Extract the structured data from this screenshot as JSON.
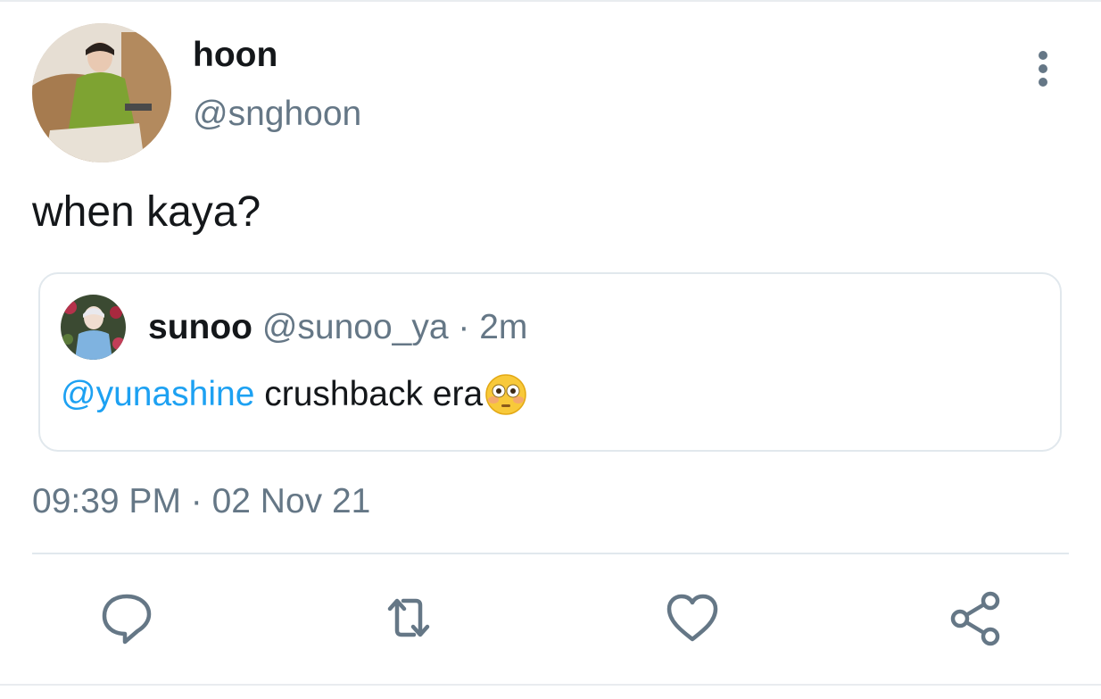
{
  "tweet": {
    "author": {
      "display_name": "hoon",
      "handle": "@snghoon"
    },
    "text": "when kaya?",
    "quoted": {
      "display_name": "sunoo",
      "handle": "@sunoo_ya",
      "separator": " · ",
      "time_ago": "2m",
      "mention": "@yunashine",
      "text": " crushback era",
      "emoji_icon": "flushed-face-icon"
    },
    "timestamp": "09:39 PM · 02 Nov 21",
    "actions": [
      "reply-icon",
      "retweet-icon",
      "like-icon",
      "share-icon"
    ]
  },
  "colors": {
    "text_primary": "#14171a",
    "text_secondary": "#657786",
    "link": "#1da1f2",
    "border": "#e1e8ed",
    "icon": "#657786"
  }
}
